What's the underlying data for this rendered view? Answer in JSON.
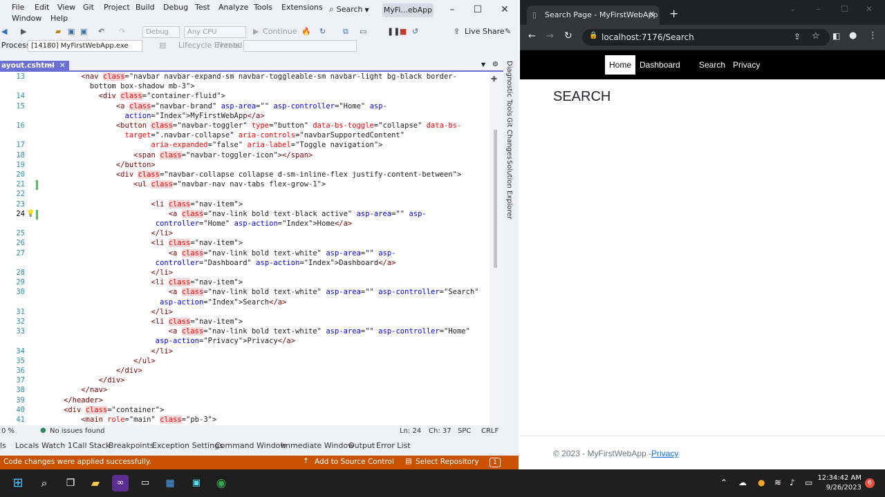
{
  "vs": {
    "menu": [
      "File",
      "Edit",
      "View",
      "Git",
      "Project",
      "Build",
      "Debug",
      "Test",
      "Analyze",
      "Tools",
      "Extensions",
      "Window",
      "Help"
    ],
    "search_label": "Search",
    "solution_name": "MyFi...ebApp",
    "toolbar": {
      "config": "Debug",
      "platform": "Any CPU",
      "continue_label": "Continue",
      "live_share": "Live Share"
    },
    "process_label": "Process:",
    "process_value": "[14180] MyFirstWebApp.exe",
    "lifecycle_label": "Lifecycle Events",
    "thread_label": "Thread:",
    "doc_tab": "ayout.cshtml",
    "side_tabs": [
      "Diagnostic Tools",
      "Git Changes",
      "Solution Explorer"
    ],
    "zoom": "0 %",
    "issues": "No issues found",
    "position": {
      "line": "Ln: 24",
      "char": "Ch: 37",
      "spc": "SPC",
      "crlf": "CRLF"
    },
    "tool_windows": [
      "ls",
      "Locals",
      "Watch 1",
      "Call Stack",
      "Breakpoints",
      "Exception Settings",
      "Command Window",
      "Immediate Window",
      "Output",
      "Error List"
    ],
    "status_message": "Code changes were applied successfully.",
    "add_source_control": "Add to Source Control",
    "select_repository": "Select Repository",
    "notif_count": "1"
  },
  "code": [
    {
      "n": "13",
      "segs": [
        [
          "",
          "    "
        ],
        [
          "t",
          "<nav "
        ],
        [
          "h a",
          "class"
        ],
        [
          "",
          "=\"navbar navbar-expand-sm navbar-toggleable-sm navbar-light bg-black border-"
        ]
      ]
    },
    {
      "n": "",
      "segs": [
        [
          "",
          "      bottom box-shadow mb-3\">"
        ]
      ]
    },
    {
      "n": "14",
      "segs": [
        [
          "",
          "        "
        ],
        [
          "t",
          "<div "
        ],
        [
          "h a",
          "class"
        ],
        [
          "",
          "=\"container-fluid\">"
        ]
      ]
    },
    {
      "n": "15",
      "segs": [
        [
          "",
          "            "
        ],
        [
          "t",
          "<a "
        ],
        [
          "h a",
          "class"
        ],
        [
          "",
          "=\"navbar-brand\" "
        ],
        [
          "p",
          "asp-area"
        ],
        [
          "",
          "=\"\" "
        ],
        [
          "p",
          "asp-controller"
        ],
        [
          "",
          "=\"Home\" "
        ],
        [
          "p",
          "asp-"
        ]
      ]
    },
    {
      "n": "",
      "segs": [
        [
          "",
          "              "
        ],
        [
          "p",
          "action"
        ],
        [
          "",
          "=\"Index\">MyFirstWebApp"
        ],
        [
          "t",
          "</a>"
        ]
      ]
    },
    {
      "n": "16",
      "segs": [
        [
          "",
          "            "
        ],
        [
          "t",
          "<button "
        ],
        [
          "h a",
          "class"
        ],
        [
          "",
          "=\"navbar-toggler\" "
        ],
        [
          "a",
          "type"
        ],
        [
          "",
          "=\"button\" "
        ],
        [
          "a",
          "data-bs-toggle"
        ],
        [
          "",
          "=\"collapse\" "
        ],
        [
          "a",
          "data-bs-"
        ]
      ]
    },
    {
      "n": "",
      "segs": [
        [
          "",
          "              "
        ],
        [
          "a",
          "target"
        ],
        [
          "",
          "=\".navbar-collapse\" "
        ],
        [
          "a",
          "aria-controls"
        ],
        [
          "",
          "=\"navbarSupportedContent\""
        ]
      ]
    },
    {
      "n": "17",
      "segs": [
        [
          "",
          "                    "
        ],
        [
          "a",
          "aria-expanded"
        ],
        [
          "",
          "=\"false\" "
        ],
        [
          "a",
          "aria-label"
        ],
        [
          "",
          "=\"Toggle navigation\">"
        ]
      ]
    },
    {
      "n": "18",
      "segs": [
        [
          "",
          "                "
        ],
        [
          "t",
          "<span "
        ],
        [
          "h a",
          "class"
        ],
        [
          "",
          "=\"navbar-toggler-icon\">"
        ],
        [
          "t",
          "</span>"
        ]
      ]
    },
    {
      "n": "19",
      "segs": [
        [
          "",
          "            "
        ],
        [
          "t",
          "</button>"
        ]
      ]
    },
    {
      "n": "20",
      "segs": [
        [
          "",
          "            "
        ],
        [
          "t",
          "<div "
        ],
        [
          "h a",
          "class"
        ],
        [
          "",
          "=\"navbar-collapse collapse d-sm-inline-flex justify-content-between\">"
        ]
      ]
    },
    {
      "n": "21",
      "segs": [
        [
          "",
          "                "
        ],
        [
          "t",
          "<ul "
        ],
        [
          "h a",
          "class"
        ],
        [
          "",
          "=\"navbar-nav nav-tabs flex-grow-1\">"
        ]
      ]
    },
    {
      "n": "22",
      "segs": [
        [
          "",
          ""
        ]
      ]
    },
    {
      "n": "23",
      "segs": [
        [
          "",
          "                    "
        ],
        [
          "t",
          "<li "
        ],
        [
          "h a",
          "class"
        ],
        [
          "",
          "=\"nav-item\">"
        ]
      ]
    },
    {
      "n": "24",
      "segs": [
        [
          "",
          "                        "
        ],
        [
          "t",
          "<a "
        ],
        [
          "h a",
          "class"
        ],
        [
          "",
          "=\"nav-link bold text-black active\" "
        ],
        [
          "p",
          "asp-area"
        ],
        [
          "",
          "=\"\" "
        ],
        [
          "p",
          "asp-"
        ]
      ]
    },
    {
      "n": "",
      "segs": [
        [
          "",
          "                     "
        ],
        [
          "p",
          "controller"
        ],
        [
          "",
          "=\"Home\" "
        ],
        [
          "p",
          "asp-action"
        ],
        [
          "",
          "=\"Index\">Home"
        ],
        [
          "t",
          "</a>"
        ]
      ]
    },
    {
      "n": "25",
      "segs": [
        [
          "",
          "                    "
        ],
        [
          "t",
          "</li>"
        ]
      ]
    },
    {
      "n": "26",
      "segs": [
        [
          "",
          "                    "
        ],
        [
          "t",
          "<li "
        ],
        [
          "h a",
          "class"
        ],
        [
          "",
          "=\"nav-item\">"
        ]
      ]
    },
    {
      "n": "27",
      "segs": [
        [
          "",
          "                        "
        ],
        [
          "t",
          "<a "
        ],
        [
          "h a",
          "class"
        ],
        [
          "",
          "=\"nav-link bold text-white\" "
        ],
        [
          "p",
          "asp-area"
        ],
        [
          "",
          "=\"\" "
        ],
        [
          "p",
          "asp-"
        ]
      ]
    },
    {
      "n": "",
      "segs": [
        [
          "",
          "                     "
        ],
        [
          "p",
          "controller"
        ],
        [
          "",
          "=\"Dashboard\" "
        ],
        [
          "p",
          "asp-action"
        ],
        [
          "",
          "=\"Index\">Dashboard"
        ],
        [
          "t",
          "</a>"
        ]
      ]
    },
    {
      "n": "28",
      "segs": [
        [
          "",
          "                    "
        ],
        [
          "t",
          "</li>"
        ]
      ]
    },
    {
      "n": "29",
      "segs": [
        [
          "",
          "                    "
        ],
        [
          "t",
          "<li "
        ],
        [
          "h a",
          "class"
        ],
        [
          "",
          "=\"nav-item\">"
        ]
      ]
    },
    {
      "n": "30",
      "segs": [
        [
          "",
          "                        "
        ],
        [
          "t",
          "<a "
        ],
        [
          "h a",
          "class"
        ],
        [
          "",
          "=\"nav-link bold text-white\" "
        ],
        [
          "p",
          "asp-area"
        ],
        [
          "",
          "=\"\" "
        ],
        [
          "p",
          "asp-controller"
        ],
        [
          "",
          "=\"Search\""
        ]
      ]
    },
    {
      "n": "",
      "segs": [
        [
          "",
          "                      "
        ],
        [
          "p",
          "asp-action"
        ],
        [
          "",
          "=\"Index\">Search"
        ],
        [
          "t",
          "</a>"
        ]
      ]
    },
    {
      "n": "31",
      "segs": [
        [
          "",
          "                    "
        ],
        [
          "t",
          "</li>"
        ]
      ]
    },
    {
      "n": "32",
      "segs": [
        [
          "",
          "                    "
        ],
        [
          "t",
          "<li "
        ],
        [
          "h a",
          "class"
        ],
        [
          "",
          "=\"nav-item\">"
        ]
      ]
    },
    {
      "n": "33",
      "segs": [
        [
          "",
          "                        "
        ],
        [
          "t",
          "<a "
        ],
        [
          "h a",
          "class"
        ],
        [
          "",
          "=\"nav-link bold text-white\" "
        ],
        [
          "p",
          "asp-area"
        ],
        [
          "",
          "=\"\" "
        ],
        [
          "p",
          "asp-controller"
        ],
        [
          "",
          "=\"Home\""
        ]
      ]
    },
    {
      "n": "",
      "segs": [
        [
          "",
          "                     "
        ],
        [
          "p",
          "asp-action"
        ],
        [
          "",
          "=\"Privacy\">Privacy"
        ],
        [
          "t",
          "</a>"
        ]
      ]
    },
    {
      "n": "34",
      "segs": [
        [
          "",
          "                    "
        ],
        [
          "t",
          "</li>"
        ]
      ]
    },
    {
      "n": "35",
      "segs": [
        [
          "",
          "                "
        ],
        [
          "t",
          "</ul>"
        ]
      ]
    },
    {
      "n": "36",
      "segs": [
        [
          "",
          "            "
        ],
        [
          "t",
          "</div>"
        ]
      ]
    },
    {
      "n": "37",
      "segs": [
        [
          "",
          "        "
        ],
        [
          "t",
          "</div>"
        ]
      ]
    },
    {
      "n": "38",
      "segs": [
        [
          "",
          "    "
        ],
        [
          "t",
          "</nav>"
        ]
      ]
    },
    {
      "n": "39",
      "segs": [
        [
          "",
          ""
        ],
        [
          "t",
          "</header>"
        ]
      ]
    },
    {
      "n": "40",
      "segs": [
        [
          "",
          ""
        ],
        [
          "t",
          "<div "
        ],
        [
          "h a",
          "class"
        ],
        [
          "",
          "=\"container\">"
        ]
      ]
    },
    {
      "n": "41",
      "segs": [
        [
          "",
          "    "
        ],
        [
          "t",
          "<main "
        ],
        [
          "a",
          "role"
        ],
        [
          "",
          "=\"main\" "
        ],
        [
          "h a",
          "class"
        ],
        [
          "",
          "=\"pb-3\">"
        ]
      ]
    }
  ],
  "chrome": {
    "tab_title": "Search Page - MyFirstWebApp",
    "url": "localhost:7176/Search"
  },
  "site": {
    "nav": [
      "Home",
      "Dashboard",
      "Search",
      "Privacy"
    ],
    "title": "SEARCH",
    "footer_text": "© 2023 - MyFirstWebApp - ",
    "footer_link": "Privacy"
  },
  "taskbar": {
    "time": "12:34:42 AM",
    "date": "9/26/2023",
    "badge": "6"
  },
  "colors": {
    "vs_accent": "#6c6fd4",
    "status_orange": "#ca5100",
    "chrome_dark": "#202124"
  }
}
